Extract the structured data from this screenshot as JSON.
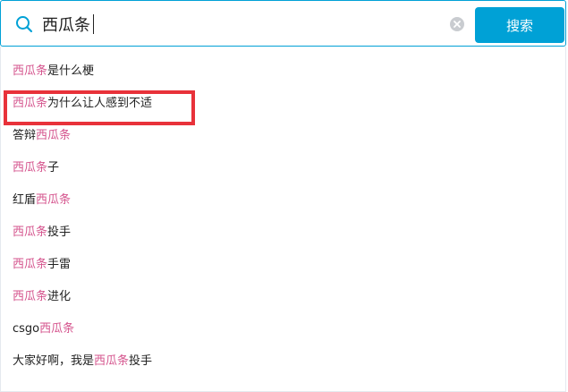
{
  "search": {
    "query": "西瓜条",
    "button_label": "搜索"
  },
  "colors": {
    "accent": "#00a1d6",
    "keyword_highlight": "#d5558e",
    "annotation_box": "#e8323a"
  },
  "suggestions": [
    {
      "before": "",
      "keyword": "西瓜条",
      "after": "是什么梗"
    },
    {
      "before": "",
      "keyword": "西瓜条",
      "after": "为什么让人感到不适"
    },
    {
      "before": "答辩",
      "keyword": "西瓜条",
      "after": ""
    },
    {
      "before": "",
      "keyword": "西瓜条",
      "after": "子"
    },
    {
      "before": "红盾",
      "keyword": "西瓜条",
      "after": ""
    },
    {
      "before": "",
      "keyword": "西瓜条",
      "after": "投手"
    },
    {
      "before": "",
      "keyword": "西瓜条",
      "after": "手雷"
    },
    {
      "before": "",
      "keyword": "西瓜条",
      "after": "进化"
    },
    {
      "before": "csgo",
      "keyword": "西瓜条",
      "after": ""
    },
    {
      "before": "大家好啊，我是",
      "keyword": "西瓜条",
      "after": "投手"
    }
  ]
}
